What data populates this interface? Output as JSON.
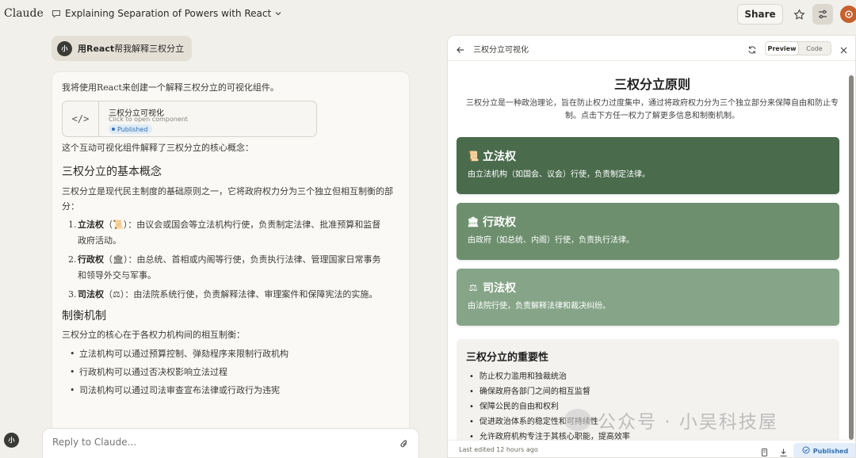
{
  "app": {
    "brand": "Claude",
    "chat_title": "Explaining Separation of Powers with React",
    "share_label": "Share",
    "avatar_initial": "小"
  },
  "user_message": {
    "avatar_initial": "小",
    "text": "用React帮我解释三权分立"
  },
  "assistant": {
    "intro": "我将使用React来创建一个解释三权分立的可视化组件。",
    "artifact": {
      "title": "三权分立可视化",
      "subtitle": "Click to open component",
      "badge": "Published"
    },
    "after_artifact": "这个互动可视化组件解释了三权分立的核心概念：",
    "section1_heading": "三权分立的基本概念",
    "section1_text": "三权分立是现代民主制度的基础原则之一，它将政府权力分为三个独立但相互制衡的部分：",
    "branches": [
      {
        "num": "1.",
        "name": "立法权",
        "emoji": "📜",
        "text": "：由议会或国会等立法机构行使，负责制定法律、批准预算和监督政府活动。"
      },
      {
        "num": "2.",
        "name": "行政权",
        "emoji": "🏛",
        "text": "：由总统、首相或内阁等行使，负责执行法律、管理国家日常事务和领导外交与军事。"
      },
      {
        "num": "3.",
        "name": "司法权",
        "emoji": "⚖",
        "text": "：由法院系统行使，负责解释法律、审理案件和保障宪法的实施。"
      }
    ],
    "section2_heading": "制衡机制",
    "section2_text": "三权分立的核心在于各权力机构间的相互制衡：",
    "checks": [
      "立法机构可以通过预算控制、弹劾程序来限制行政机构",
      "行政机构可以通过否决权影响立法过程",
      "司法机构可以通过司法审查宣布法律或行政行为违宪"
    ]
  },
  "chat_input": {
    "placeholder": "Reply to Claude..."
  },
  "panel": {
    "title": "三权分立可视化",
    "toggle": {
      "preview": "Preview",
      "code": "Code"
    },
    "footer_text": "Last edited 12 hours ago",
    "publish_label": "Published"
  },
  "preview": {
    "title": "三权分立原则",
    "desc": "三权分立是一种政治理论，旨在防止权力过度集中，通过将政府权力分为三个独立部分来保障自由和防止专制。点击下方任一权力了解更多信息和制衡机制。",
    "powers": [
      {
        "emoji": "📜",
        "name": "立法权",
        "desc": "由立法机构（如国会、议会）行使，负责制定法律。",
        "color": "#4a6b4c"
      },
      {
        "emoji": "🏛",
        "name": "行政权",
        "desc": "由政府（如总统、内阁）行使，负责执行法律。",
        "color": "#6d8f6e"
      },
      {
        "emoji": "⚖",
        "name": "司法权",
        "desc": "由法院行使，负责解释法律和裁决纠纷。",
        "color": "#86a588"
      }
    ],
    "importance_heading": "三权分立的重要性",
    "importance": [
      "防止权力滥用和独裁统治",
      "确保政府各部门之间的相互监督",
      "保障公民的自由和权利",
      "促进政治体系的稳定性和可持续性",
      "允许政府机构专注于其核心职能，提高效率"
    ]
  },
  "watermark": {
    "text": "公众号 · 小吴科技屋"
  },
  "colors": {
    "background": "#f2f0eb",
    "accent_orange": "#c6612e",
    "published_blue": "#2f6fb3"
  }
}
